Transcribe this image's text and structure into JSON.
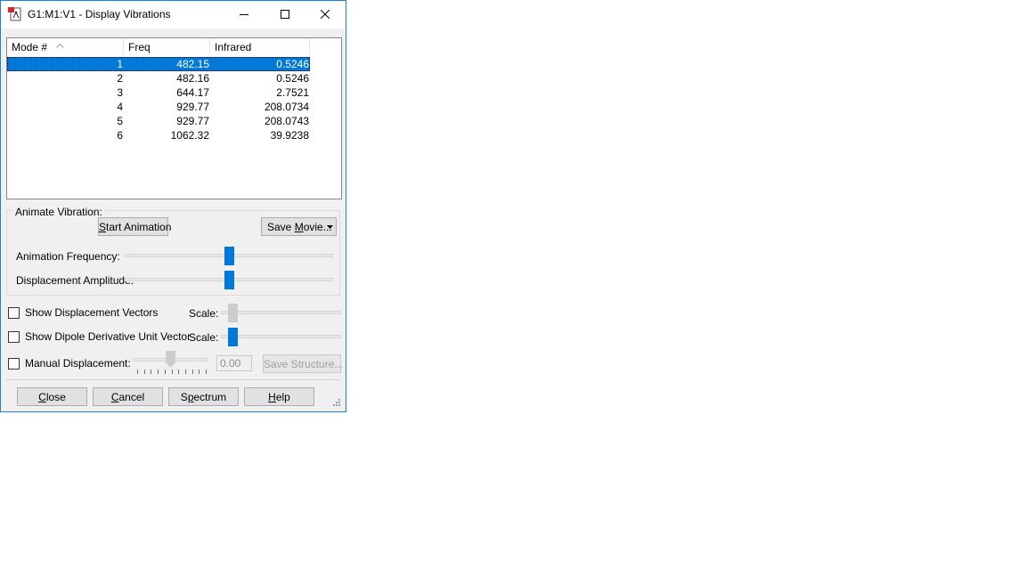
{
  "window": {
    "title": "G1:M1:V1 - Display Vibrations",
    "accent": "#0078d7"
  },
  "listview": {
    "columns": [
      "Mode #",
      "Freq",
      "Infrared"
    ],
    "sort_icon": "sort-ascending-icon",
    "rows": [
      {
        "mode": "1",
        "freq": "482.15",
        "ir": "0.5246",
        "selected": true
      },
      {
        "mode": "2",
        "freq": "482.16",
        "ir": "0.5246",
        "selected": false
      },
      {
        "mode": "3",
        "freq": "644.17",
        "ir": "2.7521",
        "selected": false
      },
      {
        "mode": "4",
        "freq": "929.77",
        "ir": "208.0734",
        "selected": false
      },
      {
        "mode": "5",
        "freq": "929.77",
        "ir": "208.0743",
        "selected": false
      },
      {
        "mode": "6",
        "freq": "1062.32",
        "ir": "39.9238",
        "selected": false
      }
    ]
  },
  "animate": {
    "group_label": "Animate Vibration:",
    "start_button_u": "S",
    "start_button_rest": "tart Animation",
    "save_movie_pre": "Save ",
    "save_movie_u": "M",
    "save_movie_rest": "ovie...",
    "frequency_label": "Animation Frequency:",
    "frequency_level": 0.5,
    "amplitude_label": "Displacement Amplitude:",
    "amplitude_level": 0.5
  },
  "options": {
    "show_vectors_label": "Show Displacement Vectors",
    "show_vectors_checked": false,
    "vectors_scale_label": "Scale:",
    "show_dipole_label": "Show Dipole Derivative Unit Vector",
    "show_dipole_checked": false,
    "dipole_scale_label": "Scale:",
    "manual_label": "Manual Displacement:",
    "manual_checked": false,
    "manual_value": "0.00",
    "save_structure_label": "Save Structure..."
  },
  "buttons": {
    "close_u": "C",
    "close_rest": "lose",
    "cancel_u": "C",
    "cancel_rest": "ancel",
    "spectrum_pre": "S",
    "spectrum_u": "p",
    "spectrum_rest": "ectrum",
    "help_u": "H",
    "help_rest": "elp"
  }
}
